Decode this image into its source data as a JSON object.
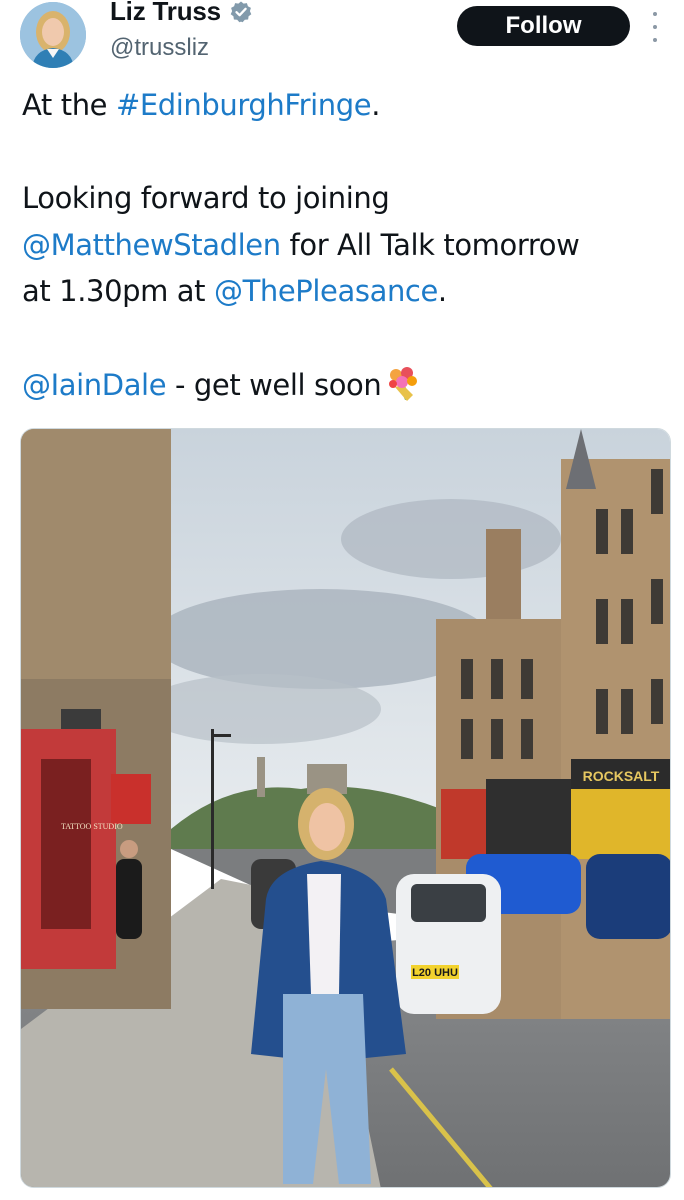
{
  "author": {
    "name": "Liz Truss",
    "handle": "@trussliz",
    "verified": true,
    "avatar_icon": "profile-photo"
  },
  "actions": {
    "follow_label": "Follow",
    "more_icon": "more-vertical-icon"
  },
  "tweet": {
    "line1_prefix": "At the ",
    "line1_link": "#EdinburghFringe",
    "line1_suffix": ".",
    "line2": "Looking forward to joining",
    "line3_link": "@MatthewStadlen",
    "line3_suffix": " for All Talk tomorrow",
    "line4_prefix": "at 1.30pm at ",
    "line4_link": "@ThePleasance",
    "line4_suffix": ".",
    "line5_link": "@IainDale",
    "line5_suffix": " - get well soon",
    "emoji_icon": "bouquet-icon"
  },
  "photo": {
    "shop_sign_right": "ROCKSALT",
    "shop_sign_left": "TATTOO STUDIO",
    "number_plate": "L20 UHU"
  },
  "colors": {
    "link": "#1d7bc8",
    "follow_bg": "#0f1419",
    "verified": "#829aab"
  }
}
